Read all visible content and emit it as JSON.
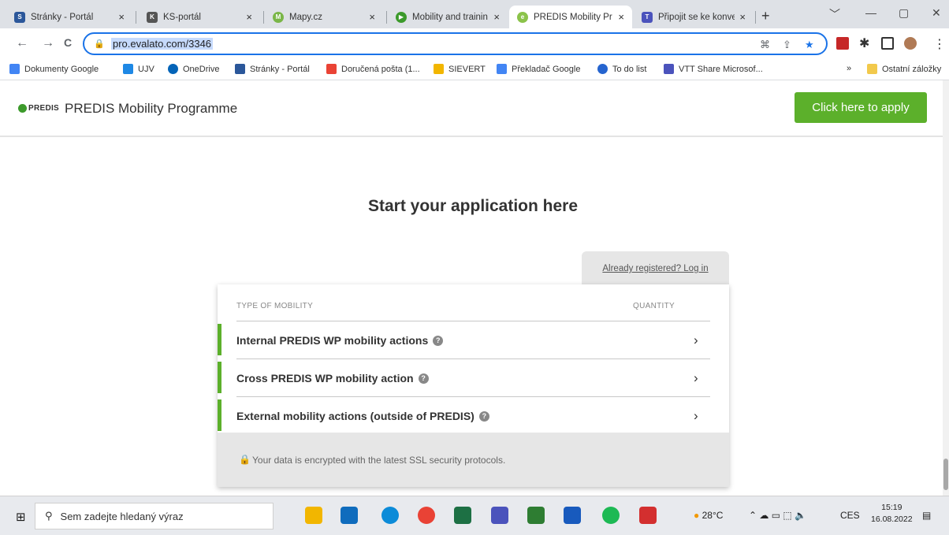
{
  "browser": {
    "tabs": [
      {
        "title": "Stránky - Portál",
        "close": "×",
        "favicon_color": "#2b579a",
        "favicon_glyph": "S"
      },
      {
        "title": "KS-portál",
        "close": "×",
        "favicon_color": "#555555",
        "favicon_glyph": "KS"
      },
      {
        "title": "Mapy.cz",
        "close": "×",
        "favicon_color": "#7ab648",
        "favicon_glyph": "M"
      },
      {
        "title": "Mobility and trainin",
        "close": "×",
        "favicon_color": "#3c9a2b",
        "favicon_glyph": "▶"
      },
      {
        "title": "PREDIS Mobility Pr",
        "close": "×",
        "favicon_color": "#8bc34a",
        "favicon_glyph": "e",
        "active": true
      },
      {
        "title": "Připojit se ke konve",
        "close": "×",
        "favicon_color": "#4b53bc",
        "favicon_glyph": "T"
      }
    ],
    "new_tab": "+",
    "window_controls": [
      "﹀",
      "—",
      "▢",
      "✕"
    ],
    "nav": {
      "back": "←",
      "forward": "→",
      "reload": "C"
    },
    "url": "pro.evalato.com/3346",
    "bookmarks": [
      {
        "label": "Dokumenty Google",
        "color": "#4285f4"
      },
      {
        "label": "UJV",
        "color": "#1e88e5"
      },
      {
        "label": "OneDrive",
        "color": "#0364b8"
      },
      {
        "label": "Stránky - Portál",
        "color": "#2b579a"
      },
      {
        "label": "Doručená pošta (1...",
        "color": "#ea4335"
      },
      {
        "label": "SIEVERT",
        "color": "#f2b600"
      },
      {
        "label": "Překladač Google",
        "color": "#4285f4"
      },
      {
        "label": "To do list",
        "color": "#2564cf"
      },
      {
        "label": "VTT Share Microsof...",
        "color": "#4b53bc"
      }
    ],
    "bookmarks_more": "»",
    "other_bookmarks": "Ostatní záložky"
  },
  "site": {
    "logo_text": "PREDIS",
    "title": "PREDIS Mobility Programme",
    "apply_button": "Click here to apply",
    "heading": "Start your application here",
    "login_link": "Already registered? Log in",
    "table": {
      "col_type": "TYPE OF MOBILITY",
      "col_quantity": "QUANTITY",
      "rows": [
        {
          "label": "Internal PREDIS WP mobility actions",
          "help": "?",
          "chevron": "›"
        },
        {
          "label": "Cross PREDIS WP mobility action",
          "help": "?",
          "chevron": "›"
        },
        {
          "label": "External mobility actions (outside of PREDIS)",
          "help": "?",
          "chevron": "›"
        }
      ]
    },
    "security_note": "Your data is encrypted with the latest SSL security protocols."
  },
  "taskbar": {
    "search_placeholder": "Sem zadejte hledaný výraz",
    "weather": "28°C",
    "language": "CES",
    "time": "15:19",
    "date": "16.08.2022"
  },
  "colors": {
    "accent_green": "#5cb02b",
    "omnibox_blue": "#1a73e8"
  }
}
